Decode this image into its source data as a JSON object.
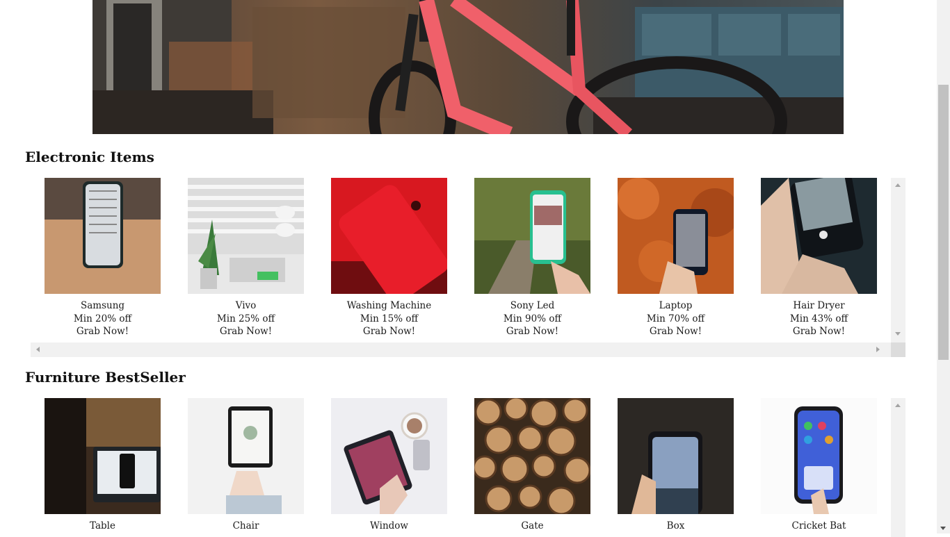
{
  "electronics": {
    "title": "Electronic Items",
    "items": [
      {
        "name": "Samsung",
        "offer": "Min 20% off",
        "cta": "Grab Now!"
      },
      {
        "name": "Vivo",
        "offer": "Min 25% off",
        "cta": "Grab Now!"
      },
      {
        "name": "Washing Machine",
        "offer": "Min 15% off",
        "cta": "Grab Now!"
      },
      {
        "name": "Sony Led",
        "offer": "Min 90% off",
        "cta": "Grab Now!"
      },
      {
        "name": "Laptop",
        "offer": "Min 70% off",
        "cta": "Grab Now!"
      },
      {
        "name": "Hair Dryer",
        "offer": "Min 43% off",
        "cta": "Grab Now!"
      }
    ]
  },
  "furniture": {
    "title": "Furniture BestSeller",
    "items": [
      {
        "name": "Table"
      },
      {
        "name": "Chair"
      },
      {
        "name": "Window"
      },
      {
        "name": "Gate"
      },
      {
        "name": "Box"
      },
      {
        "name": "Cricket Bat"
      }
    ]
  },
  "colors": {
    "background": "#ffffff",
    "scrollbar_track": "#f1f1f1",
    "scrollbar_thumb": "#c1c1c1",
    "bike_frame": "#f0606a"
  }
}
